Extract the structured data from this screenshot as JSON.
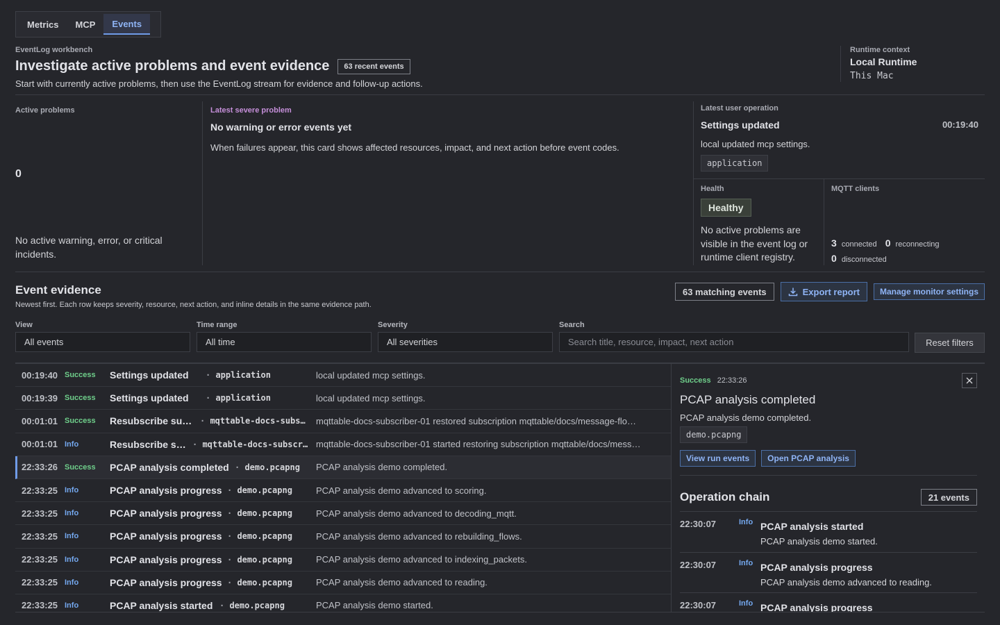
{
  "tabs": [
    {
      "label": "Metrics",
      "active": false
    },
    {
      "label": "MCP",
      "active": false
    },
    {
      "label": "Events",
      "active": true
    }
  ],
  "header": {
    "eyebrow": "EventLog workbench",
    "title": "Investigate active problems and event evidence",
    "recent_badge": "63 recent events",
    "subtitle": "Start with currently active problems, then use the EventLog stream for evidence and follow-up actions."
  },
  "runtime": {
    "eyebrow": "Runtime context",
    "name": "Local Runtime",
    "host": "This Mac"
  },
  "active_problems": {
    "eyebrow": "Active problems",
    "count": "0",
    "message": "No active warning, error, or critical incidents."
  },
  "severe": {
    "eyebrow": "Latest severe problem",
    "title": "No warning or error events yet",
    "description": "When failures appear, this card shows affected resources, impact, and next action before event codes."
  },
  "user_op": {
    "eyebrow": "Latest user operation",
    "title": "Settings updated",
    "time": "00:19:40",
    "description": "local updated mcp settings.",
    "chip": "application"
  },
  "health": {
    "eyebrow": "Health",
    "status": "Healthy",
    "description": "No active problems are visible in the event log or runtime client registry."
  },
  "mqtt": {
    "eyebrow": "MQTT clients",
    "connected": "3",
    "connected_label": "connected",
    "reconnecting": "0",
    "reconnecting_label": "reconnecting",
    "disconnected": "0",
    "disconnected_label": "disconnected"
  },
  "evidence": {
    "title": "Event evidence",
    "subtitle": "Newest first. Each row keeps severity, resource, next action, and inline details in the same evidence path.",
    "matching": "63 matching events",
    "export_label": "Export report",
    "manage_label": "Manage monitor settings"
  },
  "filters": {
    "view_label": "View",
    "view_value": "All events",
    "time_label": "Time range",
    "time_value": "All time",
    "severity_label": "Severity",
    "severity_value": "All severities",
    "search_label": "Search",
    "search_placeholder": "Search title, resource, impact, next action",
    "reset_label": "Reset filters"
  },
  "events": [
    {
      "time": "00:19:40",
      "severity": "Success",
      "title": "Settings updated",
      "resource": "application",
      "message": "local updated mcp settings."
    },
    {
      "time": "00:19:39",
      "severity": "Success",
      "title": "Settings updated",
      "resource": "application",
      "message": "local updated mcp settings."
    },
    {
      "time": "00:01:01",
      "severity": "Success",
      "title": "Resubscribe su…",
      "resource": "mqttable-docs-subs…",
      "message": "mqttable-docs-subscriber-01 restored subscription mqttable/docs/message-flo…"
    },
    {
      "time": "00:01:01",
      "severity": "Info",
      "title": "Resubscribe s…",
      "resource": "mqttable-docs-subscr…",
      "message": "mqttable-docs-subscriber-01 started restoring subscription mqttable/docs/mess…"
    },
    {
      "time": "22:33:26",
      "severity": "Success",
      "title": "PCAP analysis completed",
      "resource": "demo.pcapng",
      "message": "PCAP analysis demo completed."
    },
    {
      "time": "22:33:25",
      "severity": "Info",
      "title": "PCAP analysis progress",
      "resource": "demo.pcapng",
      "message": "PCAP analysis demo advanced to scoring."
    },
    {
      "time": "22:33:25",
      "severity": "Info",
      "title": "PCAP analysis progress",
      "resource": "demo.pcapng",
      "message": "PCAP analysis demo advanced to decoding_mqtt."
    },
    {
      "time": "22:33:25",
      "severity": "Info",
      "title": "PCAP analysis progress",
      "resource": "demo.pcapng",
      "message": "PCAP analysis demo advanced to rebuilding_flows."
    },
    {
      "time": "22:33:25",
      "severity": "Info",
      "title": "PCAP analysis progress",
      "resource": "demo.pcapng",
      "message": "PCAP analysis demo advanced to indexing_packets."
    },
    {
      "time": "22:33:25",
      "severity": "Info",
      "title": "PCAP analysis progress",
      "resource": "demo.pcapng",
      "message": "PCAP analysis demo advanced to reading."
    },
    {
      "time": "22:33:25",
      "severity": "Info",
      "title": "PCAP analysis started",
      "resource": "demo.pcapng",
      "message": "PCAP analysis demo started."
    }
  ],
  "detail": {
    "severity": "Success",
    "time": "22:33:26",
    "title": "PCAP analysis completed",
    "description": "PCAP analysis demo completed.",
    "chip": "demo.pcapng",
    "view_run_label": "View run events",
    "open_pcap_label": "Open PCAP analysis",
    "chain_title": "Operation chain",
    "chain_count": "21 events",
    "chain": [
      {
        "time": "22:30:07",
        "severity": "Info",
        "title": "PCAP analysis started",
        "description": "PCAP analysis demo started."
      },
      {
        "time": "22:30:07",
        "severity": "Info",
        "title": "PCAP analysis progress",
        "description": "PCAP analysis demo advanced to reading."
      },
      {
        "time": "22:30:07",
        "severity": "Info",
        "title": "PCAP analysis progress",
        "description": ""
      }
    ]
  },
  "colors": {
    "background": "#25262b",
    "accent": "#8fb4f5",
    "success": "#6fcf8b",
    "info": "#74a8ef",
    "severe": "#c58fd9"
  }
}
